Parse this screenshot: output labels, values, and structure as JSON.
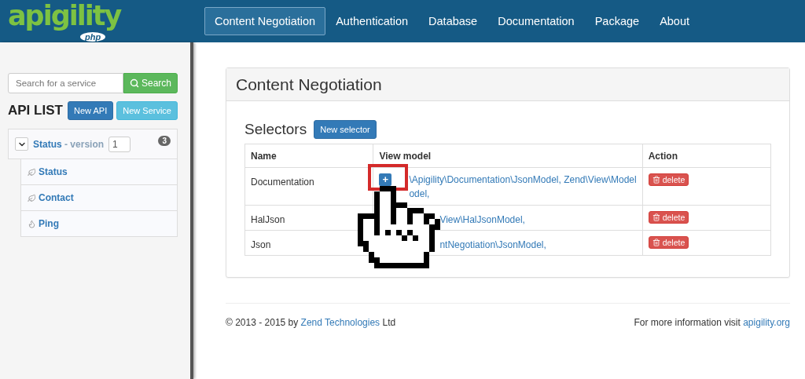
{
  "logo": {
    "name": "apigility",
    "badge": "php"
  },
  "nav": [
    {
      "label": "Content Negotiation",
      "selected": true
    },
    {
      "label": "Authentication",
      "selected": false
    },
    {
      "label": "Database",
      "selected": false
    },
    {
      "label": "Documentation",
      "selected": false
    },
    {
      "label": "Package",
      "selected": false
    },
    {
      "label": "About",
      "selected": false
    }
  ],
  "sidebar": {
    "search": {
      "placeholder": "Search for a service",
      "button": "Search"
    },
    "heading": "API LIST",
    "buttons": [
      "New API",
      "New Service"
    ],
    "api": {
      "name": "Status",
      "version_label": "- version",
      "version": "1",
      "count": "3",
      "expanded": true,
      "children": [
        {
          "label": "Status",
          "kind": "rest"
        },
        {
          "label": "Contact",
          "kind": "rest"
        },
        {
          "label": "Ping",
          "kind": "rpc"
        }
      ]
    }
  },
  "panel": {
    "title": "Content Negotiation",
    "section": "Selectors",
    "new_button": "New selector",
    "table": {
      "columns": [
        "Name",
        "View model",
        "Action"
      ],
      "rows": [
        {
          "name": "Documentation",
          "expand_button": "+",
          "view_model": [
            "\\Apigility\\Documentation\\JsonModel, Zend\\View\\Model",
            "odel,"
          ],
          "action": "delete"
        },
        {
          "name": "HalJson",
          "view_model": [
            "View\\HalJsonModel,"
          ],
          "action": "delete"
        },
        {
          "name": "Json",
          "view_model": [
            "ntNegotiation\\JsonModel,"
          ],
          "action": "delete"
        }
      ]
    }
  },
  "footer": {
    "copyright": "© 2013 - 2015 by",
    "company": "Zend Technologies",
    "company_suffix": "Ltd",
    "info": "For more information visit",
    "link": "apigility.org"
  }
}
